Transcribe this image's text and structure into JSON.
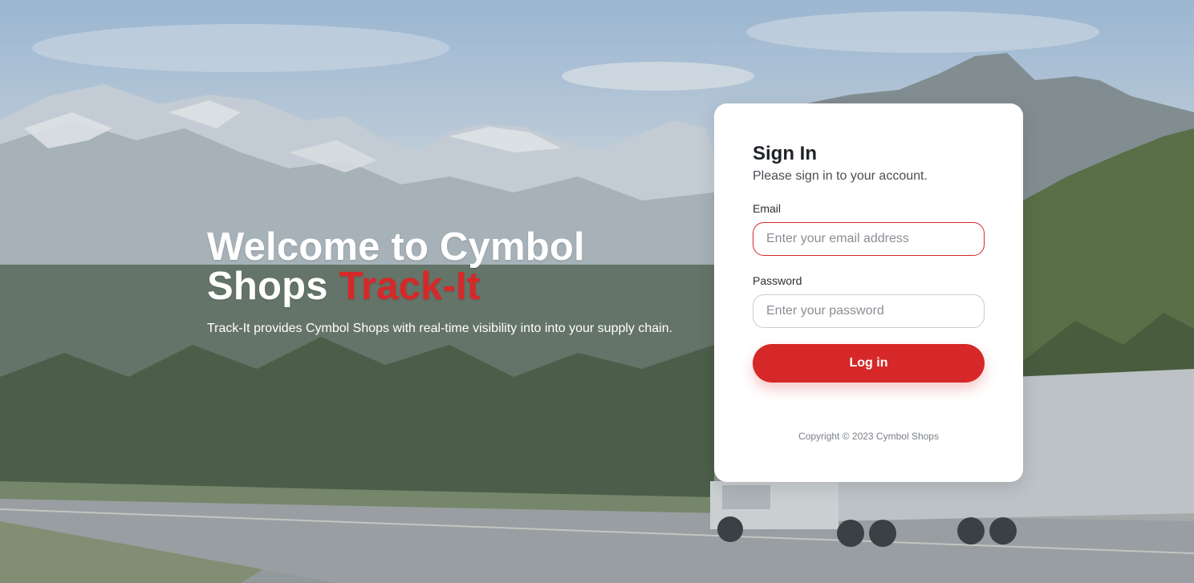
{
  "background": {
    "description_icon": "mountain-truck-photo-icon"
  },
  "hero": {
    "title_part1": "Welcome to Cymbol Shops",
    "title_accent": "Track-It",
    "subtitle": "Track-It provides Cymbol Shops with real-time visibility into into your supply chain.",
    "accent_color": "#d62828"
  },
  "signin": {
    "title": "Sign In",
    "subtitle": "Please sign in to your account.",
    "email_label": "Email",
    "email_placeholder": "Enter your email address",
    "email_value": "",
    "password_label": "Password",
    "password_placeholder": "Enter your password",
    "password_value": "",
    "login_label": "Log in",
    "copyright": "Copyright © 2023 Cymbol Shops"
  },
  "colors": {
    "brand": "#d62828",
    "card": "#ffffff"
  }
}
